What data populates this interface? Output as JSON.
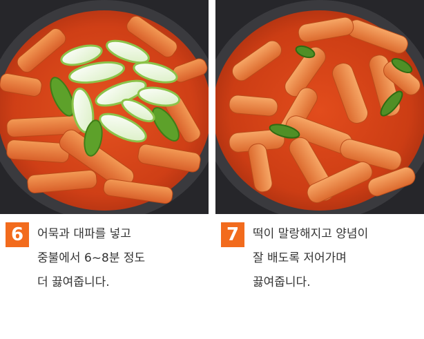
{
  "steps": [
    {
      "number": "6",
      "lines": [
        "어묵과 대파를 넣고",
        "중불에서 6~8분 정도",
        "더 끓여줍니다."
      ],
      "photo": "tteokbokki-with-fishcake-and-green-onion"
    },
    {
      "number": "7",
      "lines": [
        "떡이 말랑해지고 양념이",
        "잘 배도록 저어가며",
        "끓여줍니다."
      ],
      "photo": "tteokbokki-simmered-and-stirred"
    }
  ],
  "colors": {
    "badge": "#f26b1d",
    "text": "#333333",
    "sauce": "#d8461c",
    "pot": "#2b2b2e"
  }
}
